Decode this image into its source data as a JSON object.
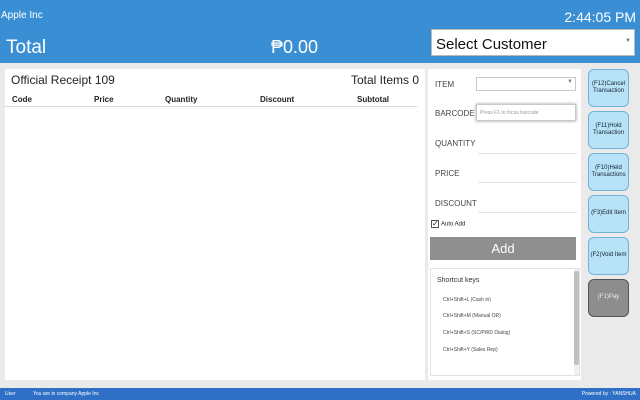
{
  "header": {
    "company": "Apple Inc",
    "time": "2:44:05 PM",
    "total_label": "Total",
    "total_amount": "₱0.00",
    "customer_select": "Select Customer"
  },
  "receipt": {
    "title": "Official Receipt 109",
    "total_items": "Total Items 0",
    "columns": [
      "Code",
      "Price",
      "Quantity",
      "Discount",
      "Subtotal"
    ],
    "rows": []
  },
  "form": {
    "item_label": "ITEM",
    "item_value": "",
    "barcode_label": "BARCODE",
    "barcode_placeholder": "Press F1 to focus barcode",
    "quantity_label": "QUANTITY",
    "price_label": "PRICE",
    "discount_label": "DISCOUNT",
    "auto_add_label": "Auto Add",
    "auto_add_checked": true,
    "add_button": "Add"
  },
  "shortcuts": {
    "title": "Shortcut keys",
    "items": [
      "Ctrl+Shift+L (Cash in)",
      "Ctrl+Shift+M (Manual OR)",
      "Ctrl+Shift+S (SC/PWD Dialog)",
      "Ctrl+Shift+Y (Sales Rep)"
    ]
  },
  "actions": [
    {
      "label": "(F12)Cancel Transaction"
    },
    {
      "label": "(F11)Hold Transaction"
    },
    {
      "label": "(F10)Held Transactions"
    },
    {
      "label": "(F3)Edit Item"
    },
    {
      "label": "(F2)Void Item"
    },
    {
      "label": "(F1)Pay"
    }
  ],
  "status": {
    "user": "User",
    "company_message": "You are in company Apple Inc",
    "powered_by": "Powered by : YANSHUA"
  },
  "colors": {
    "header": "#3a8fd4",
    "status_bar": "#2f6fc5",
    "action_button": "#b7e2f7",
    "pay_button": "#8d8d8d",
    "add_button": "#8f8f8f"
  },
  "icons": {
    "customer_dropdown": "chevron-down-icon",
    "item_dropdown": "chevron-down-icon",
    "auto_add_checkbox": "checkmark-icon"
  }
}
